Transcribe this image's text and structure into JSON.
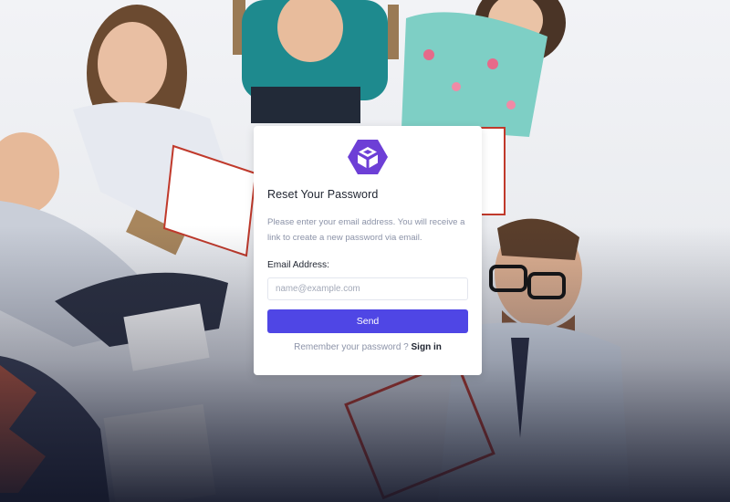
{
  "colors": {
    "accent": "#4f46e5",
    "logo": "#6d3fd6",
    "card_bg": "#ffffff",
    "muted_text": "#8c93a8",
    "dark_text": "#1f2430"
  },
  "brand": {
    "icon": "hexagon-cube-logo-icon"
  },
  "reset_form": {
    "title": "Reset Your Password",
    "description": "Please enter your email address. You will receive a link to create a new password via email.",
    "email_label": "Email Address:",
    "email_placeholder": "name@example.com",
    "email_value": "",
    "send_label": "Send"
  },
  "footer": {
    "prompt": "Remember your password ?",
    "signin_label": "Sign in"
  }
}
